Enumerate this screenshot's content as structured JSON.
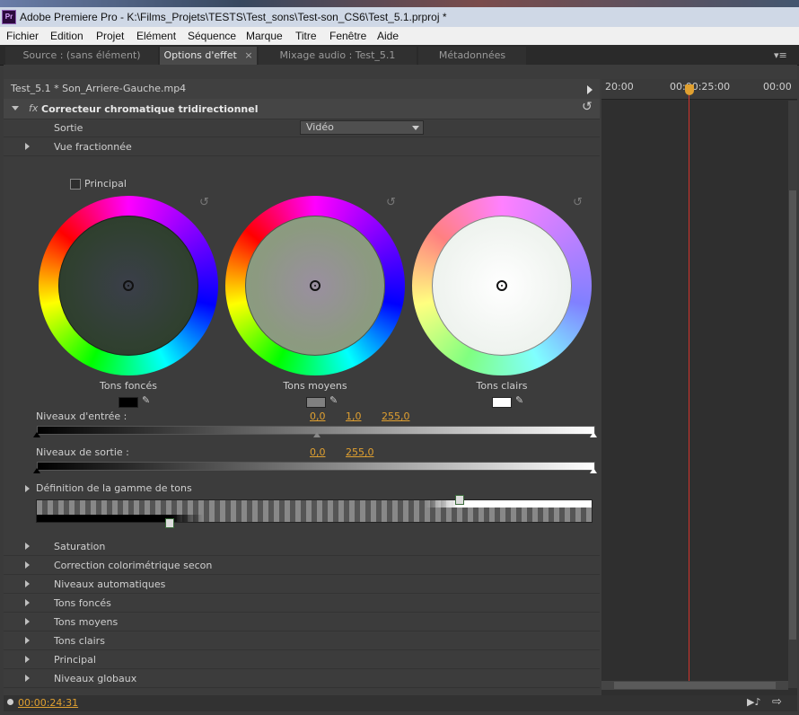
{
  "window": {
    "title": "Adobe Premiere Pro - K:\\Films_Projets\\TESTS\\Test_sons\\Test-son_CS6\\Test_5.1.prproj *",
    "app_icon": "Pr"
  },
  "menu": [
    "Fichier",
    "Edition",
    "Projet",
    "Elément",
    "Séquence",
    "Marque",
    "Titre",
    "Fenêtre",
    "Aide"
  ],
  "tabs": [
    {
      "label": "Source : (sans élément)",
      "active": false
    },
    {
      "label": "Options d'effet",
      "active": true,
      "close": "×"
    },
    {
      "label": "Mixage audio : Test_5.1",
      "active": false
    },
    {
      "label": "Métadonnées",
      "active": false
    }
  ],
  "clip": {
    "name": "Test_5.1 * Son_Arriere-Gauche.mp4"
  },
  "timeline": {
    "labels": [
      "20:00",
      "00:00:25:00",
      "00:00"
    ]
  },
  "effect": {
    "fx_label": "fx",
    "name": "Correcteur chromatique tridirectionnel",
    "output_label": "Sortie",
    "output_value": "Vidéo",
    "split_view": "Vue fractionnée",
    "principal_checkbox": "Principal",
    "wheels": [
      {
        "label": "Tons foncés",
        "swatch": "#000000"
      },
      {
        "label": "Tons moyens",
        "swatch": "#808080"
      },
      {
        "label": "Tons clairs",
        "swatch": "#ffffff"
      }
    ],
    "input_levels": {
      "label": "Niveaux d'entrée :",
      "black": "0,0",
      "gamma": "1,0",
      "white": "255,0"
    },
    "output_levels": {
      "label": "Niveaux de sortie :",
      "black": "0,0",
      "white": "255,0"
    },
    "tonal_range": "Définition de la gamme de tons",
    "sections": [
      "Saturation",
      "Correction colorimétrique secon",
      "Niveaux automatiques",
      "Tons foncés",
      "Tons moyens",
      "Tons clairs",
      "Principal",
      "Niveaux globaux"
    ]
  },
  "status": {
    "timecode": "00:00:24:31"
  },
  "colors": {
    "accent": "#e0a030",
    "playhead": "#d0342c"
  }
}
